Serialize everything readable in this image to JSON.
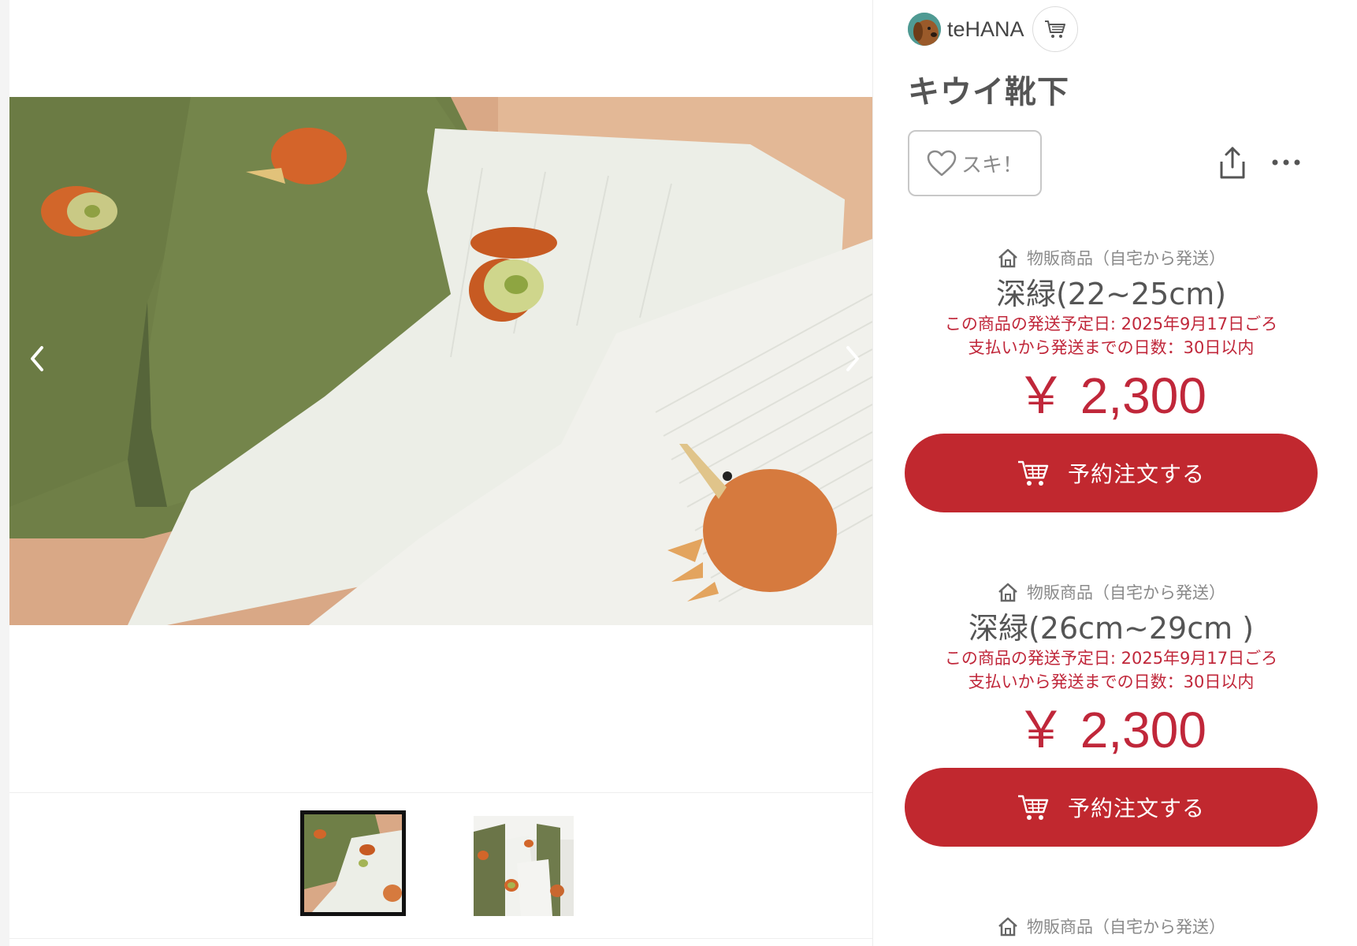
{
  "creator": {
    "name": "teHANA",
    "avatar_icon": "dog-avatar",
    "shop_icon": "cart-icon"
  },
  "product": {
    "title": "キウイ靴下",
    "like_label": "スキ！"
  },
  "gallery": {
    "prev_icon": "chevron-left-icon",
    "next_icon": "chevron-right-icon"
  },
  "listings": [
    {
      "ship_type": "物販商品（自宅から発送）",
      "variant": "深緑(22~25cm)",
      "ship_date": "この商品の発送予定日: 2025年9月17日ごろ",
      "ship_days": "支払いから発送までの日数：30日以内",
      "price": "￥ 2,300",
      "button_label": "予約注文する"
    },
    {
      "ship_type": "物販商品（自宅から発送）",
      "variant": "深緑(26cm~29cm )",
      "ship_date": "この商品の発送予定日: 2025年9月17日ごろ",
      "ship_days": "支払いから発送までの日数：30日以内",
      "price": "￥ 2,300",
      "button_label": "予約注文する"
    },
    {
      "ship_type": "物販商品（自宅から発送）"
    }
  ],
  "colors": {
    "accent": "#c1282f",
    "price": "#c0273a",
    "sock_green": "#6e7e45",
    "sock_white": "#eceee8"
  }
}
